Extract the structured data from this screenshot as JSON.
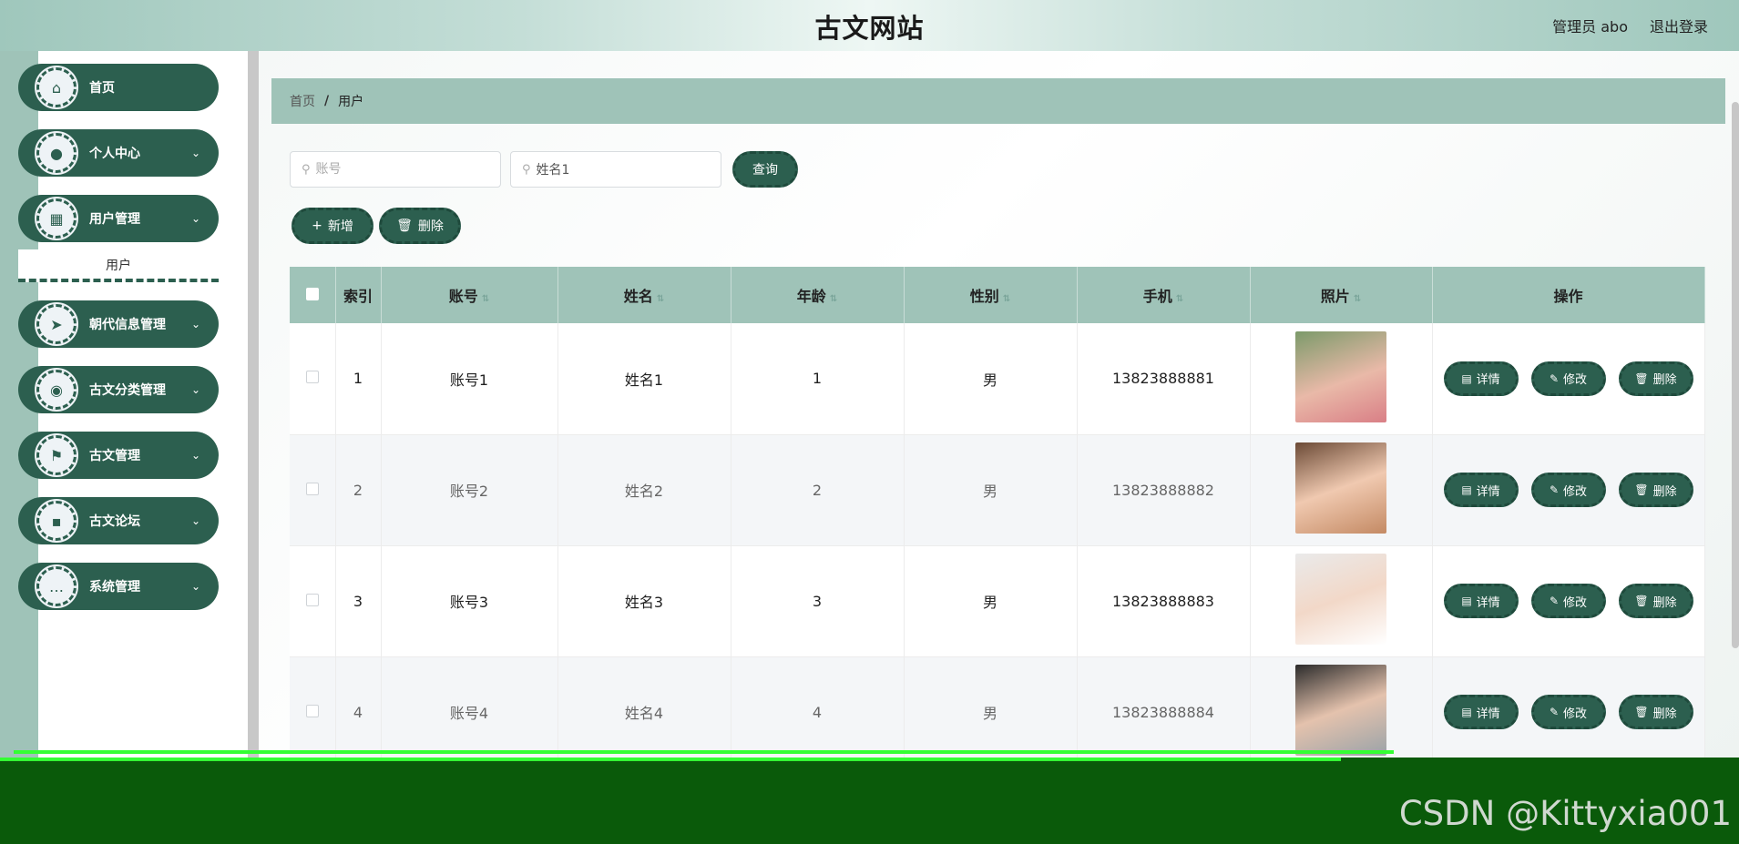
{
  "header": {
    "title": "古文网站",
    "user": "管理员 abo",
    "logout": "退出登录"
  },
  "sidebar": {
    "items": [
      {
        "label": "首页",
        "icon": "home-icon",
        "glyph": "⌂",
        "chevron": ""
      },
      {
        "label": "个人中心",
        "icon": "user-icon",
        "glyph": "●",
        "chevron": "⌄"
      },
      {
        "label": "用户管理",
        "icon": "grid-icon",
        "glyph": "▦",
        "chevron": "⌄"
      },
      {
        "label": "朝代信息管理",
        "icon": "send-icon",
        "glyph": "➤",
        "chevron": "⌄"
      },
      {
        "label": "古文分类管理",
        "icon": "bulb-icon",
        "glyph": "◉",
        "chevron": "⌄"
      },
      {
        "label": "古文管理",
        "icon": "flag-icon",
        "glyph": "⚑",
        "chevron": "⌄"
      },
      {
        "label": "古文论坛",
        "icon": "apps-icon",
        "glyph": "▪",
        "chevron": "⌄"
      },
      {
        "label": "系统管理",
        "icon": "chat-icon",
        "glyph": "…",
        "chevron": "⌄"
      }
    ],
    "submenu": "用户"
  },
  "breadcrumb": {
    "home": "首页",
    "separator": "/",
    "current": "用户"
  },
  "search": {
    "account_placeholder": "账号",
    "account_value": "",
    "name_placeholder": "姓名",
    "name_value": "姓名1",
    "query_label": "查询"
  },
  "actions": {
    "add_label": "新增",
    "delete_label": "删除"
  },
  "table": {
    "headers": {
      "index": "索引",
      "account": "账号",
      "name": "姓名",
      "age": "年龄",
      "gender": "性别",
      "phone": "手机",
      "photo": "照片",
      "ops": "操作"
    },
    "rows": [
      {
        "index": "1",
        "account": "账号1",
        "name": "姓名1",
        "age": "1",
        "gender": "男",
        "phone": "13823888881"
      },
      {
        "index": "2",
        "account": "账号2",
        "name": "姓名2",
        "age": "2",
        "gender": "男",
        "phone": "13823888882"
      },
      {
        "index": "3",
        "account": "账号3",
        "name": "姓名3",
        "age": "3",
        "gender": "男",
        "phone": "13823888883"
      },
      {
        "index": "4",
        "account": "账号4",
        "name": "姓名4",
        "age": "4",
        "gender": "男",
        "phone": "13823888884"
      }
    ],
    "op_labels": {
      "detail": "详情",
      "edit": "修改",
      "delete": "删除"
    }
  },
  "colors": {
    "accent": "#2c5f4f",
    "header_bg": "#9fc3b8",
    "footer": "#0a5a0a"
  },
  "watermark": "CSDN @Kittyxia001"
}
